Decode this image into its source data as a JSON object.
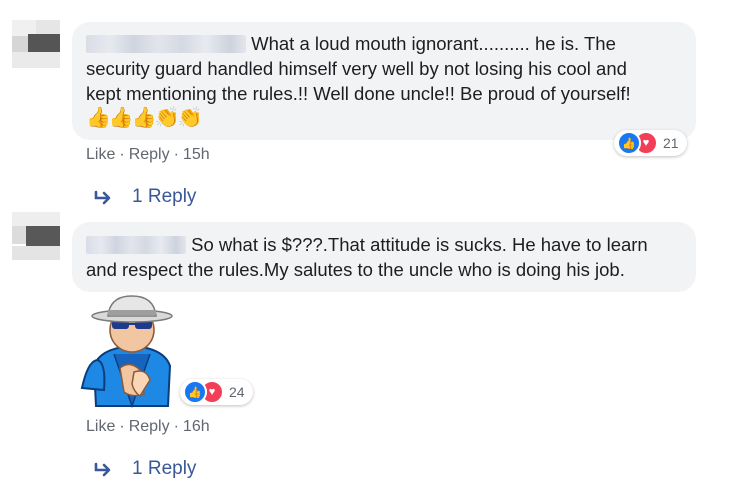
{
  "comments": [
    {
      "text_line1": "What a loud mouth ignorant.......... he is. The",
      "text_line2": "security guard handled himself very well by not losing his cool and",
      "text_line3": "kept mentioning the rules.!! Well done uncle!! Be proud of yourself!",
      "emojis": "👍👍👍👏👏",
      "reaction_count": "21",
      "like_label": "Like",
      "reply_label": "Reply",
      "time": "15h",
      "replies_label": "1 Reply"
    },
    {
      "text_line1": "So what is $???.That attitude is sucks. He have to learn",
      "text_line2": "and respect the rules.My salutes to the uncle who is doing his job.",
      "reaction_count": "24",
      "like_label": "Like",
      "reply_label": "Reply",
      "time": "16h",
      "replies_label": "1 Reply"
    }
  ],
  "colors": {
    "bubble": "#f2f3f5",
    "link": "#385898",
    "meta": "#606770",
    "like": "#1877f2",
    "love": "#f33e58"
  },
  "icons": {
    "like": "thumbs-up-icon",
    "love": "heart-icon",
    "reply_arrow": "reply-arrow-icon",
    "sticker": "clapping-uncle-sticker"
  }
}
